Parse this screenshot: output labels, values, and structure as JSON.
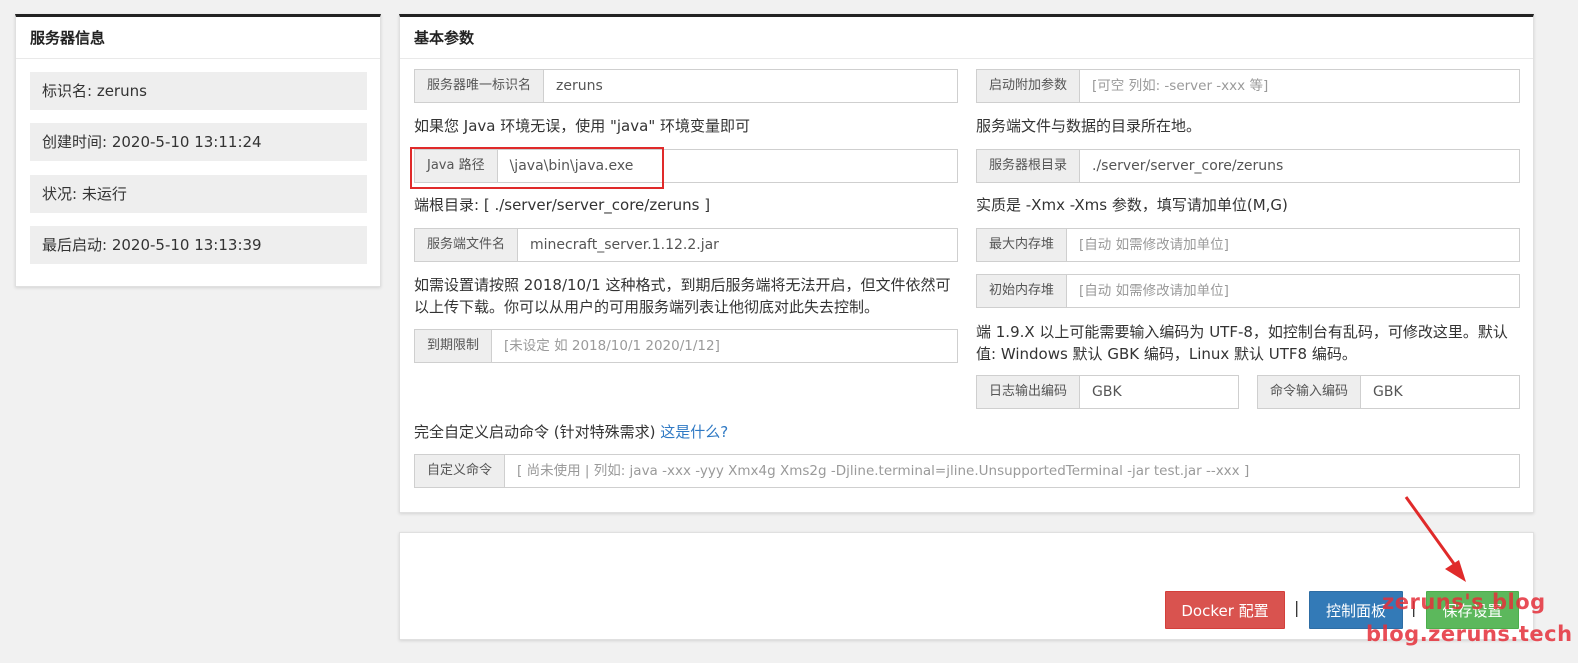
{
  "server_info": {
    "title": "服务器信息",
    "items": [
      "标识名: zeruns",
      "创建时间: 2020-5-10 13:11:24",
      "状况: 未运行",
      "最后启动: 2020-5-10 13:13:39"
    ]
  },
  "basic_params": {
    "title": "基本参数",
    "unique_id": {
      "label": "服务器唯一标识名",
      "value": "zeruns"
    },
    "java_hint": "如果您 Java 环境无误，使用 \"java\" 环境变量即可",
    "java_path": {
      "label": "Java 路径",
      "value": "\\java\\bin\\java.exe"
    },
    "root_hint": "端根目录: [ ./server/server_core/zeruns ]",
    "server_file": {
      "label": "服务端文件名",
      "value": "minecraft_server.1.12.2.jar"
    },
    "expire_hint": "如需设置请按照 2018/10/1 这种格式，到期后服务端将无法开启，但文件依然可以上传下载。你可以从用户的可用服务端列表让他彻底对此失去控制。",
    "expire": {
      "label": "到期限制",
      "placeholder": "[未设定 如 2018/10/1 2020/1/12]"
    },
    "extra_args": {
      "label": "启动附加参数",
      "placeholder": "[可空 列如: -server -xxx 等]"
    },
    "dir_hint": "服务端文件与数据的目录所在地。",
    "root_dir": {
      "label": "服务器根目录",
      "value": "./server/server_core/zeruns"
    },
    "mem_hint": "实质是 -Xmx -Xms 参数，填写请加单位(M,G)",
    "max_mem": {
      "label": "最大内存堆",
      "placeholder": "[自动 如需修改请加单位]"
    },
    "init_mem": {
      "label": "初始内存堆",
      "placeholder": "[自动 如需修改请加单位]"
    },
    "encoding_hint": "端 1.9.X 以上可能需要输入编码为 UTF-8，如控制台有乱码，可修改这里。默认值: Windows 默认 GBK 编码，Linux 默认 UTF8 编码。",
    "log_encoding": {
      "label": "日志输出编码",
      "value": "GBK"
    },
    "cmd_encoding": {
      "label": "命令输入编码",
      "value": "GBK"
    },
    "custom_hint": "完全自定义启动命令 (针对特殊需求)",
    "custom_link": "这是什么?",
    "custom_cmd": {
      "label": "自定义命令",
      "placeholder": "[ 尚未使用 | 列如:  java -xxx -yyy Xmx4g Xms2g -Djline.terminal=jline.UnsupportedTerminal -jar test.jar --xxx ]"
    }
  },
  "actions": {
    "docker_label": "Docker 配置",
    "separator": "|",
    "console_label": "控制面板",
    "save_label": "保存设置"
  },
  "watermark": {
    "line1": "zeruns's blog",
    "line2": "blog.zeruns.tech"
  },
  "colors": {
    "danger": "#d9534f",
    "primary": "#337ab7",
    "success": "#5cb85c",
    "highlight": "#e02a2a"
  }
}
